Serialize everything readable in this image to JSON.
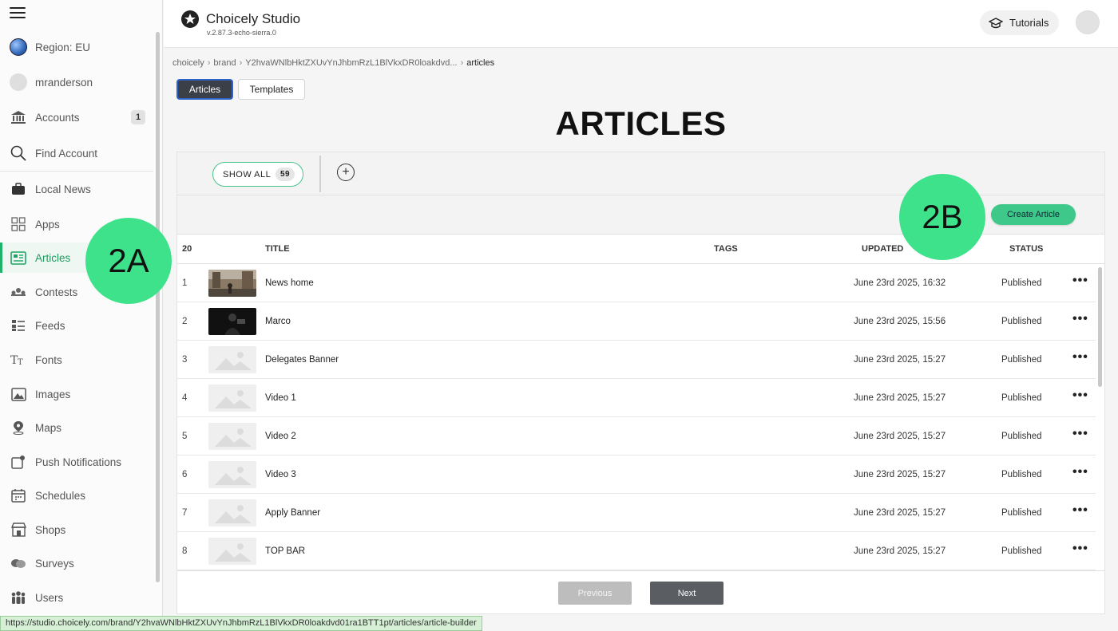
{
  "sidebar": {
    "items": [
      {
        "name": "sidebar-item-region",
        "label": "Region: EU",
        "icon": "globe-icon",
        "badge": ""
      },
      {
        "name": "sidebar-item-user",
        "label": "mranderson",
        "icon": "user-avatar-icon",
        "badge": ""
      },
      {
        "name": "sidebar-item-accounts",
        "label": "Accounts",
        "icon": "bank-icon",
        "badge": "1"
      },
      {
        "name": "sidebar-item-find-account",
        "label": "Find Account",
        "icon": "search-icon",
        "badge": ""
      },
      {
        "name": "sidebar-item-local-news",
        "label": "Local News",
        "icon": "briefcase-icon",
        "badge": ""
      },
      {
        "name": "sidebar-item-apps",
        "label": "Apps",
        "icon": "apps-grid-icon",
        "badge": ""
      },
      {
        "name": "sidebar-item-articles",
        "label": "Articles",
        "icon": "article-icon",
        "badge": "",
        "active": true
      },
      {
        "name": "sidebar-item-contests",
        "label": "Contests",
        "icon": "contest-icon",
        "badge": ""
      },
      {
        "name": "sidebar-item-feeds",
        "label": "Feeds",
        "icon": "feed-list-icon",
        "badge": ""
      },
      {
        "name": "sidebar-item-fonts",
        "label": "Fonts",
        "icon": "font-icon",
        "badge": ""
      },
      {
        "name": "sidebar-item-images",
        "label": "Images",
        "icon": "image-icon",
        "badge": ""
      },
      {
        "name": "sidebar-item-maps",
        "label": "Maps",
        "icon": "map-pin-icon",
        "badge": ""
      },
      {
        "name": "sidebar-item-push-notifications",
        "label": "Push Notifications",
        "icon": "push-notification-icon",
        "badge": ""
      },
      {
        "name": "sidebar-item-schedules",
        "label": "Schedules",
        "icon": "calendar-icon",
        "badge": ""
      },
      {
        "name": "sidebar-item-shops",
        "label": "Shops",
        "icon": "shop-icon",
        "badge": ""
      },
      {
        "name": "sidebar-item-surveys",
        "label": "Surveys",
        "icon": "survey-icon",
        "badge": ""
      },
      {
        "name": "sidebar-item-users",
        "label": "Users",
        "icon": "users-icon",
        "badge": ""
      }
    ]
  },
  "header": {
    "title": "Choicely Studio",
    "version": "v.2.87.3-echo-sierra.0",
    "tutorials_label": "Tutorials"
  },
  "breadcrumb": {
    "items": [
      "choicely",
      "brand",
      "Y2hvaWNlbHktZXUvYnJhbmRzL1BlVkxDR0loakdvd..."
    ],
    "current": "articles"
  },
  "tabs": {
    "articles": "Articles",
    "templates": "Templates"
  },
  "page": {
    "title": "ARTICLES"
  },
  "filters": {
    "show_all_label": "SHOW ALL",
    "show_all_count": "59",
    "add_symbol": "+"
  },
  "actions": {
    "create_label": "Create Article"
  },
  "table": {
    "header": {
      "count": "20",
      "title": "TITLE",
      "tags": "TAGS",
      "updated": "UPDATED",
      "status": "STATUS"
    },
    "rows": [
      {
        "num": "1",
        "title": "News home",
        "updated": "June 23rd 2025, 16:32",
        "status": "Published",
        "thumb": "photo-street"
      },
      {
        "num": "2",
        "title": "Marco",
        "updated": "June 23rd 2025, 15:56",
        "status": "Published",
        "thumb": "photo-dark"
      },
      {
        "num": "3",
        "title": "Delegates Banner",
        "updated": "June 23rd 2025, 15:27",
        "status": "Published",
        "thumb": "placeholder"
      },
      {
        "num": "4",
        "title": "Video 1",
        "updated": "June 23rd 2025, 15:27",
        "status": "Published",
        "thumb": "placeholder"
      },
      {
        "num": "5",
        "title": "Video 2",
        "updated": "June 23rd 2025, 15:27",
        "status": "Published",
        "thumb": "placeholder"
      },
      {
        "num": "6",
        "title": "Video 3",
        "updated": "June 23rd 2025, 15:27",
        "status": "Published",
        "thumb": "placeholder"
      },
      {
        "num": "7",
        "title": "Apply Banner",
        "updated": "June 23rd 2025, 15:27",
        "status": "Published",
        "thumb": "placeholder"
      },
      {
        "num": "8",
        "title": "TOP BAR",
        "updated": "June 23rd 2025, 15:27",
        "status": "Published",
        "thumb": "placeholder"
      }
    ],
    "more_symbol": "•••"
  },
  "pagination": {
    "previous_label": "Previous",
    "next_label": "Next"
  },
  "callouts": {
    "a": "2A",
    "b": "2B"
  },
  "status_bar": {
    "url": "https://studio.choicely.com/brand/Y2hvaWNlbHktZXUvYnJhbmRzL1BlVkxDR0loakdvd01ra1BTT1pt/articles/article-builder"
  },
  "colors": {
    "accent": "#3ec98a",
    "callout": "#3ee28a",
    "active_tab": "#3b3f47"
  }
}
